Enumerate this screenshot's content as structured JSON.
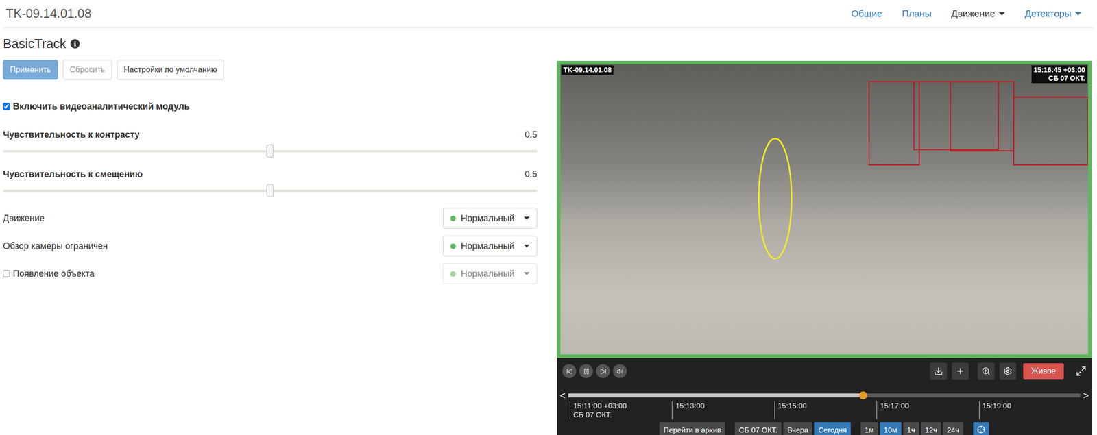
{
  "header": {
    "title": "TK-09.14.01.08",
    "nav": [
      {
        "label": "Общие",
        "dropdown": false,
        "selected": false
      },
      {
        "label": "Планы",
        "dropdown": false,
        "selected": false
      },
      {
        "label": "Движение",
        "dropdown": true,
        "selected": true
      },
      {
        "label": "Детекторы",
        "dropdown": true,
        "selected": false
      }
    ]
  },
  "panel": {
    "title": "BasicTrack",
    "buttons": [
      {
        "label": "Применить",
        "kind": "primary",
        "disabled": true
      },
      {
        "label": "Сбросить",
        "kind": "default",
        "disabled": true
      },
      {
        "label": "Настройки по умолчанию",
        "kind": "default",
        "disabled": false
      }
    ],
    "enable": {
      "label": "Включить видеоаналитический модуль",
      "checked": true
    },
    "sliders": [
      {
        "label": "Чувствительность к контрасту",
        "level": 0.5,
        "reading": "0.5"
      },
      {
        "label": "Чувствительность к смещению",
        "level": 0.5,
        "reading": "0.5"
      }
    ],
    "events": [
      {
        "kind": "plain",
        "label": "Движение",
        "value": "Нормальный",
        "color": "#5cb85c",
        "disabled": false
      },
      {
        "kind": "plain",
        "label": "Обзор камеры ограничен",
        "value": "Нормальный",
        "color": "#5cb85c",
        "disabled": false
      },
      {
        "kind": "checkbox",
        "label": "Появление объекта",
        "checked": false,
        "value": "Нормальный",
        "color": "#5cb85c",
        "disabled": true
      }
    ]
  },
  "player": {
    "camera": "TK-09.14.01.08",
    "time": "15:16:45 +03:00",
    "date": "СБ 07 ОКТ.",
    "live": "Живое",
    "timeline": {
      "level": 0.576,
      "prev": "<",
      "next": ">",
      "ticks": [
        {
          "label": "15:11:00 +03:00",
          "sub": "СБ 07 ОКТ."
        },
        {
          "label": "15:13:00",
          "sub": ""
        },
        {
          "label": "15:15:00",
          "sub": ""
        },
        {
          "label": "15:17:00",
          "sub": ""
        },
        {
          "label": "15:19:00",
          "sub": ""
        }
      ]
    },
    "archive_button": "Перейти в архив",
    "days": [
      {
        "label": "СБ 07 ОКТ.",
        "selected": false
      },
      {
        "label": "Вчера",
        "selected": false
      },
      {
        "label": "Сегодня",
        "selected": true
      }
    ],
    "ranges": [
      {
        "label": "1м",
        "selected": false
      },
      {
        "label": "10м",
        "selected": true
      },
      {
        "label": "1ч",
        "selected": false
      },
      {
        "label": "12ч",
        "selected": false
      },
      {
        "label": "24ч",
        "selected": false
      }
    ]
  }
}
